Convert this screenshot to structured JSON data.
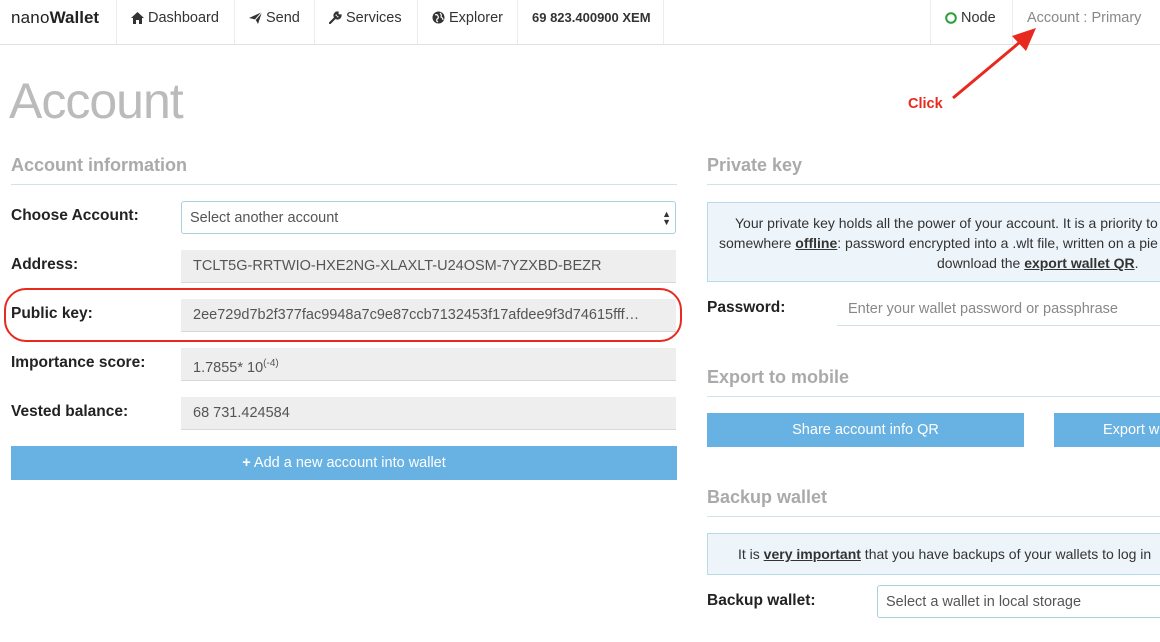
{
  "navbar": {
    "brand_light": "nano",
    "brand_bold": "Wallet",
    "dashboard": "Dashboard",
    "send": "Send",
    "services": "Services",
    "explorer": "Explorer",
    "balance": "69 823.400900 XEM",
    "node": "Node",
    "account": "Account : Primary"
  },
  "annotation": {
    "click": "Click"
  },
  "page": {
    "title": "Account"
  },
  "account_info": {
    "heading": "Account information",
    "choose_label": "Choose Account:",
    "choose_value": "Select another account",
    "address_label": "Address:",
    "address": "TCLT5G-RRTWIO-HXE2NG-XLAXLT-U24OSM-7YZXBD-BEZR",
    "pubkey_label": "Public key:",
    "pubkey": "2ee729d7b2f377fac9948a7c9e87ccb7132453f17afdee9f3d74615fff…",
    "importance_label": "Importance score:",
    "importance_base": "1.7855* 10",
    "importance_exp": "(-4)",
    "vested_label": "Vested balance:",
    "vested": "68 731.424584",
    "add_button": "Add a new account into wallet"
  },
  "private_key": {
    "heading": "Private key",
    "info_line1": "Your private key holds all the power of your account. It is a priority to",
    "info_line2_pre": "somewhere ",
    "info_line2_link": "offline",
    "info_line2_post": ": password encrypted into a .wlt file, written on a pie",
    "info_line3_pre": "download the ",
    "info_line3_link": "export wallet QR",
    "info_line3_post": ".",
    "password_label": "Password:",
    "password_placeholder": "Enter your wallet password or passphrase"
  },
  "export_mobile": {
    "heading": "Export to mobile",
    "share_button": "Share account info QR",
    "export_button": "Export wa"
  },
  "backup": {
    "heading": "Backup wallet",
    "info_pre": "It is ",
    "info_link": "very important",
    "info_post": " that you have backups of your wallets to log in",
    "label": "Backup wallet:",
    "select_value": "Select a wallet in local storage"
  },
  "colors": {
    "button_blue": "#67b2e3",
    "annotation_red": "#e8291d",
    "node_green": "#2e9e3b"
  }
}
